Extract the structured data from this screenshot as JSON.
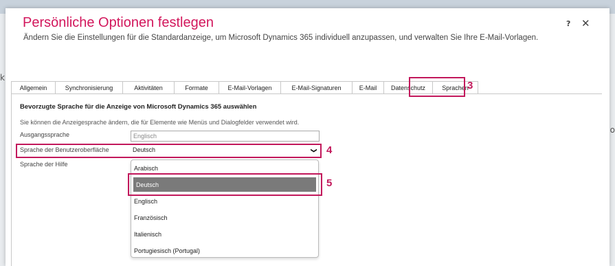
{
  "dialog": {
    "title": "Persönliche Optionen festlegen",
    "subtitle": "Ändern Sie die Einstellungen für die Standardanzeige, um Microsoft Dynamics 365 individuell anzupassen, und verwalten Sie Ihre E-Mail-Vorlagen.",
    "help": "?",
    "close": "✕"
  },
  "background": {
    "left_glyph": "k",
    "right_glyph": "o"
  },
  "tabs": [
    {
      "label": "Allgemein"
    },
    {
      "label": "Synchronisierung"
    },
    {
      "label": "Aktivitäten"
    },
    {
      "label": "Formate"
    },
    {
      "label": "E-Mail-Vorlagen"
    },
    {
      "label": "E-Mail-Signaturen"
    },
    {
      "label": "E-Mail"
    },
    {
      "label": "Datenschutz"
    },
    {
      "label": "Sprachen"
    }
  ],
  "active_tab": "Sprachen",
  "callouts": {
    "tab": "3",
    "select": "4",
    "option": "5"
  },
  "section": {
    "heading": "Bevorzugte Sprache für die Anzeige von Microsoft Dynamics 365 auswählen",
    "description": "Sie können die Anzeigesprache ändern, die für Elemente wie Menüs und Dialogfelder verwendet wird."
  },
  "fields": {
    "base_language": {
      "label": "Ausgangssprache",
      "value": "Englisch"
    },
    "ui_language": {
      "label": "Sprache der Benutzeroberfläche",
      "value": "Deutsch",
      "icon": "chevron-down-icon"
    },
    "help_language": {
      "label": "Sprache der Hilfe"
    }
  },
  "dropdown_options": [
    {
      "label": "Arabisch"
    },
    {
      "label": "Deutsch"
    },
    {
      "label": "Englisch"
    },
    {
      "label": "Französisch"
    },
    {
      "label": "Italienisch"
    },
    {
      "label": "Portugiesisch (Portugal)"
    }
  ],
  "selected_option": "Deutsch",
  "colors": {
    "title": "#D2175C",
    "annotation": "#C2185B",
    "selected_option_bg": "#7A7A7A"
  }
}
